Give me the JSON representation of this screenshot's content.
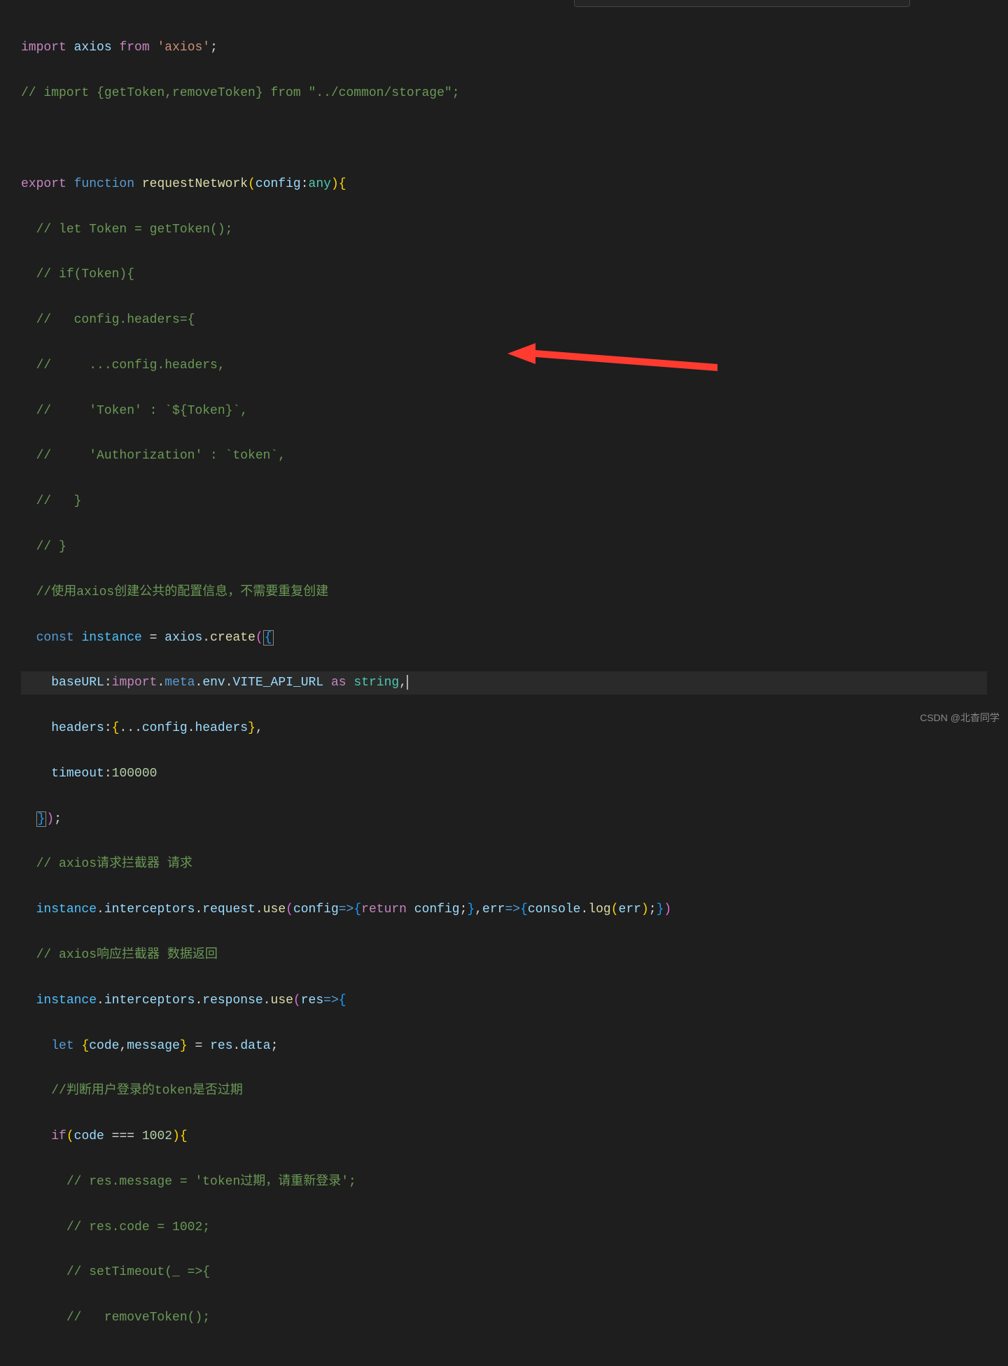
{
  "code": {
    "line1": {
      "import": "import",
      "axios": "axios",
      "from": "from",
      "str": "'axios'",
      "semi": ";"
    },
    "line2": "// import {getToken,removeToken} from \"../common/storage\";",
    "line4": {
      "export": "export",
      "function": "function",
      "name": "requestNetwork",
      "lparen": "(",
      "param": "config",
      "colon": ":",
      "type": "any",
      "rparen": ")",
      "lbrace": "{"
    },
    "line5": "// let Token = getToken();",
    "line6": "// if(Token){",
    "line7": "//   config.headers={",
    "line8": "//     ...config.headers,",
    "line9": "//     'Token' : `${Token}`,",
    "line10": "//     'Authorization' : `token`,",
    "line11": "//   }",
    "line12": "// }",
    "line13": "//使用axios创建公共的配置信息，不需要重复创建",
    "line14": {
      "const": "const",
      "instance": "instance",
      "eq": " = ",
      "axios": "axios",
      "dot": ".",
      "create": "create",
      "lparen": "(",
      "lbrace": "{"
    },
    "line15": {
      "baseURL": "baseURL",
      "colon": ":",
      "import": "import",
      "dot1": ".",
      "meta": "meta",
      "dot2": ".",
      "env": "env",
      "dot3": ".",
      "vite": "VITE_API_URL",
      "as": "as",
      "string": "string",
      "comma": ","
    },
    "line16": {
      "headers": "headers",
      "colon": ":",
      "lbrace": "{",
      "spread": "...",
      "config": "config",
      "dot": ".",
      "headers2": "headers",
      "rbrace": "}",
      "comma": ","
    },
    "line17": {
      "timeout": "timeout",
      "colon": ":",
      "val": "100000"
    },
    "line18": {
      "rbrace": "}",
      "rparen": ")",
      "semi": ";"
    },
    "line19": "// axios请求拦截器 请求",
    "line20": {
      "instance": "instance",
      "dot1": ".",
      "interceptors": "interceptors",
      "dot2": ".",
      "request": "request",
      "dot3": ".",
      "use": "use",
      "lparen": "(",
      "config": "config",
      "arrow": "=>",
      "lbrace": "{",
      "return": "return",
      "config2": "config",
      "semi1": ";",
      "rbrace": "}",
      "comma": ",",
      "err": "err",
      "arrow2": "=>",
      "lbrace2": "{",
      "console": "console",
      "dot4": ".",
      "log": "log",
      "lparen2": "(",
      "err2": "err",
      "rparen2": ")",
      "semi2": ";",
      "rbrace2": "}",
      "rparen": ")"
    },
    "line21": "// axios响应拦截器 数据返回",
    "line22": {
      "instance": "instance",
      "dot1": ".",
      "interceptors": "interceptors",
      "dot2": ".",
      "response": "response",
      "dot3": ".",
      "use": "use",
      "lparen": "(",
      "res": "res",
      "arrow": "=>",
      "lbrace": "{"
    },
    "line23": {
      "let": "let",
      "lbrace": "{",
      "code": "code",
      "comma": ",",
      "message": "message",
      "rbrace": "}",
      "eq": " = ",
      "res": "res",
      "dot": ".",
      "data": "data",
      "semi": ";"
    },
    "line24": "//判断用户登录的token是否过期",
    "line25": {
      "if": "if",
      "lparen": "(",
      "code": "code",
      "eqeq": " === ",
      "val": "1002",
      "rparen": ")",
      "lbrace": "{"
    },
    "line26": "// res.message = 'token过期，请重新登录';",
    "line27": "// res.code = 1002;",
    "line28": "// setTimeout(_ =>{",
    "line29": "//   removeToken();"
  },
  "watermark": "CSDN @北杳同学"
}
